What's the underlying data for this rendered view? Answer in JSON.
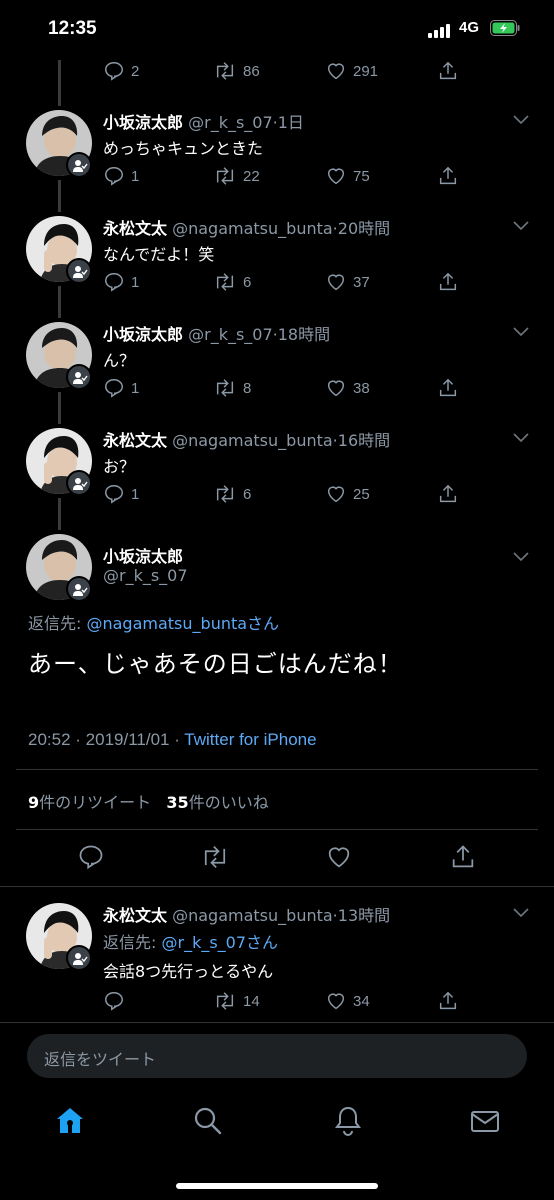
{
  "status_bar": {
    "time": "12:35",
    "network": "4G"
  },
  "tweets": [
    {
      "name": "小坂涼太郎",
      "handle": "@r_k_s_07",
      "time": "1日",
      "text": "めっちゃキュンときた",
      "replies": "1",
      "retweets": "22",
      "likes": "75"
    },
    {
      "name": "永松文太",
      "handle": "@nagamatsu_bunta",
      "time": "20時間",
      "text": "なんでだよ！笑",
      "replies": "1",
      "retweets": "6",
      "likes": "37"
    },
    {
      "name": "小坂涼太郎",
      "handle": "@r_k_s_07",
      "time": "18時間",
      "text": "ん？",
      "replies": "1",
      "retweets": "8",
      "likes": "38"
    },
    {
      "name": "永松文太",
      "handle": "@nagamatsu_bunta",
      "time": "16時間",
      "text": "お？",
      "replies": "1",
      "retweets": "6",
      "likes": "25"
    }
  ],
  "top_partial": {
    "replies": "2",
    "retweets": "86",
    "likes": "291"
  },
  "focus_tweet": {
    "name": "小坂涼太郎",
    "handle": "@r_k_s_07",
    "reply_to_label": "返信先: ",
    "reply_to_user": "@nagamatsu_bunta",
    "reply_to_suffix": "さん",
    "text": "あー、じゃあその日ごはんだね！",
    "time": "20:52",
    "date": "2019/11/01",
    "source": "Twitter for iPhone",
    "retweet_count": "9",
    "retweet_label": "件のリツイート",
    "like_count": "35",
    "like_label": "件のいいね"
  },
  "reply_tweet": {
    "name": "永松文太",
    "handle": "@nagamatsu_bunta",
    "time": "13時間",
    "reply_to_label": "返信先: ",
    "reply_to_user": "@r_k_s_07",
    "reply_to_suffix": "さん",
    "text": "会話8つ先行っとるやん",
    "replies": "",
    "retweets": "14",
    "likes": "34"
  },
  "reply_input": {
    "placeholder": "返信をツイート"
  },
  "tabs": [
    "home-icon",
    "search-icon",
    "notifications-icon",
    "messages-icon"
  ],
  "colors": {
    "accent": "#1da1f2",
    "link": "#5da9f5",
    "muted": "#8b98a5",
    "background": "#000000"
  }
}
